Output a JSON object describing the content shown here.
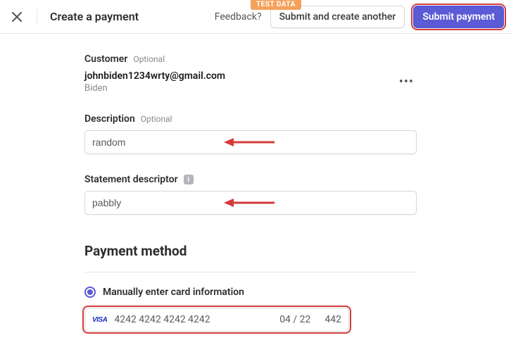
{
  "header": {
    "title": "Create a payment",
    "test_badge": "TEST DATA",
    "feedback": "Feedback?",
    "submit_another": "Submit and create another",
    "submit": "Submit payment"
  },
  "customer": {
    "label": "Customer",
    "optional": "Optional",
    "email": "johnbiden1234wrty@gmail.com",
    "name": "Biden"
  },
  "description": {
    "label": "Description",
    "optional": "Optional",
    "value": "random"
  },
  "statement": {
    "label": "Statement descriptor",
    "value": "pabbly"
  },
  "payment_method": {
    "title": "Payment method",
    "manual_label": "Manually enter card information",
    "card": {
      "brand": "VISA",
      "number": "4242 4242 4242 4242",
      "expiry": "04 / 22",
      "cvc": "442"
    }
  }
}
